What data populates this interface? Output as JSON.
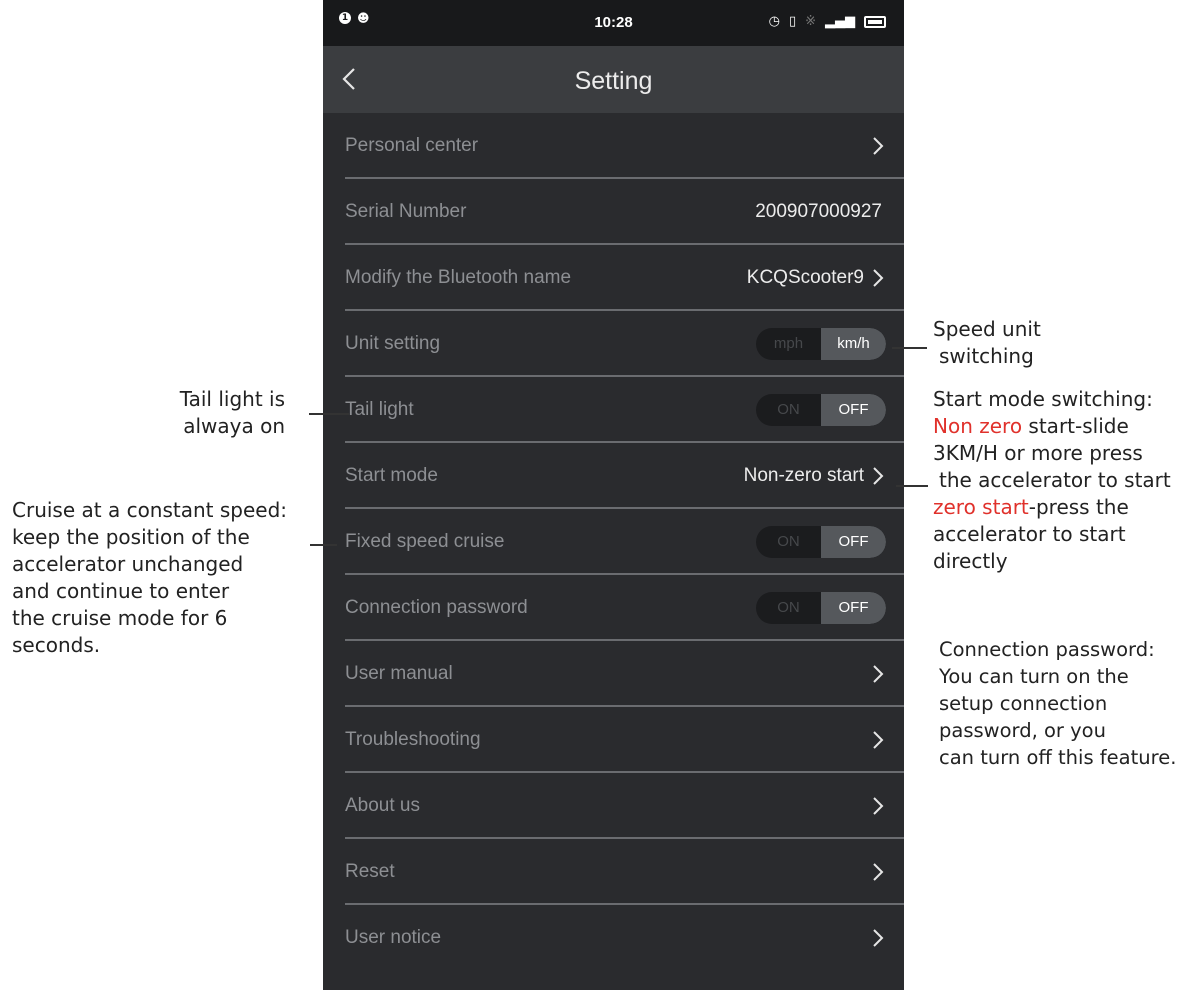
{
  "status_bar": {
    "left_badge": "1",
    "left_icon": "person-group-icon",
    "time": "10:28",
    "right_icons": [
      "alarm-icon",
      "vibrate-icon",
      "bluetooth-icon",
      "signal-icon",
      "battery-icon"
    ]
  },
  "header": {
    "title": "Setting",
    "back_icon": "chevron-left-icon"
  },
  "settings": {
    "personal_center": {
      "label": "Personal center"
    },
    "serial_number": {
      "label": "Serial Number",
      "value": "200907000927"
    },
    "bluetooth_name": {
      "label": "Modify the Bluetooth name",
      "value": "KCQScooter9"
    },
    "unit_setting": {
      "label": "Unit setting",
      "option_1": "mph",
      "option_2": "km/h",
      "selected": "km/h"
    },
    "tail_light": {
      "label": "Tail light",
      "on": "ON",
      "off": "OFF",
      "selected": "OFF"
    },
    "start_mode": {
      "label": "Start mode",
      "value": "Non-zero start"
    },
    "fixed_speed_cruise": {
      "label": "Fixed speed cruise",
      "on": "ON",
      "off": "OFF",
      "selected": "OFF"
    },
    "connection_password": {
      "label": "Connection password",
      "on": "ON",
      "off": "OFF",
      "selected": "OFF"
    },
    "user_manual": {
      "label": "User manual"
    },
    "troubleshooting": {
      "label": "Troubleshooting"
    },
    "about_us": {
      "label": "About us"
    },
    "reset": {
      "label": "Reset"
    },
    "user_notice": {
      "label": "User notice"
    }
  },
  "annotations": {
    "tail_light": [
      "Tail light is",
      "alwaya on"
    ],
    "cruise": [
      "Cruise at a constant speed:",
      "keep the position of the",
      "accelerator unchanged",
      "and continue to enter",
      "the cruise mode for 6",
      "seconds."
    ],
    "speed_unit": [
      "Speed unit",
      "switching"
    ],
    "start_mode": {
      "line_1": "Start mode switching:",
      "line_2_red": "Non zero",
      "line_2_rest": " start-slide",
      "line_3": "3KM/H or more press",
      "line_4": "the accelerator to start",
      "line_5_red": "zero start",
      "line_5_rest": "-press the",
      "line_6": "accelerator to start",
      "line_7": "directly"
    },
    "connection_password": [
      "Connection password:",
      "You can turn on the",
      "setup connection",
      "password, or you",
      "can turn off this feature."
    ]
  },
  "colors": {
    "screen_background": "#2a2b2e",
    "status_bar": "#18191b",
    "nav_bar": "#3b3d40",
    "highlight_red": "#e0312b"
  }
}
